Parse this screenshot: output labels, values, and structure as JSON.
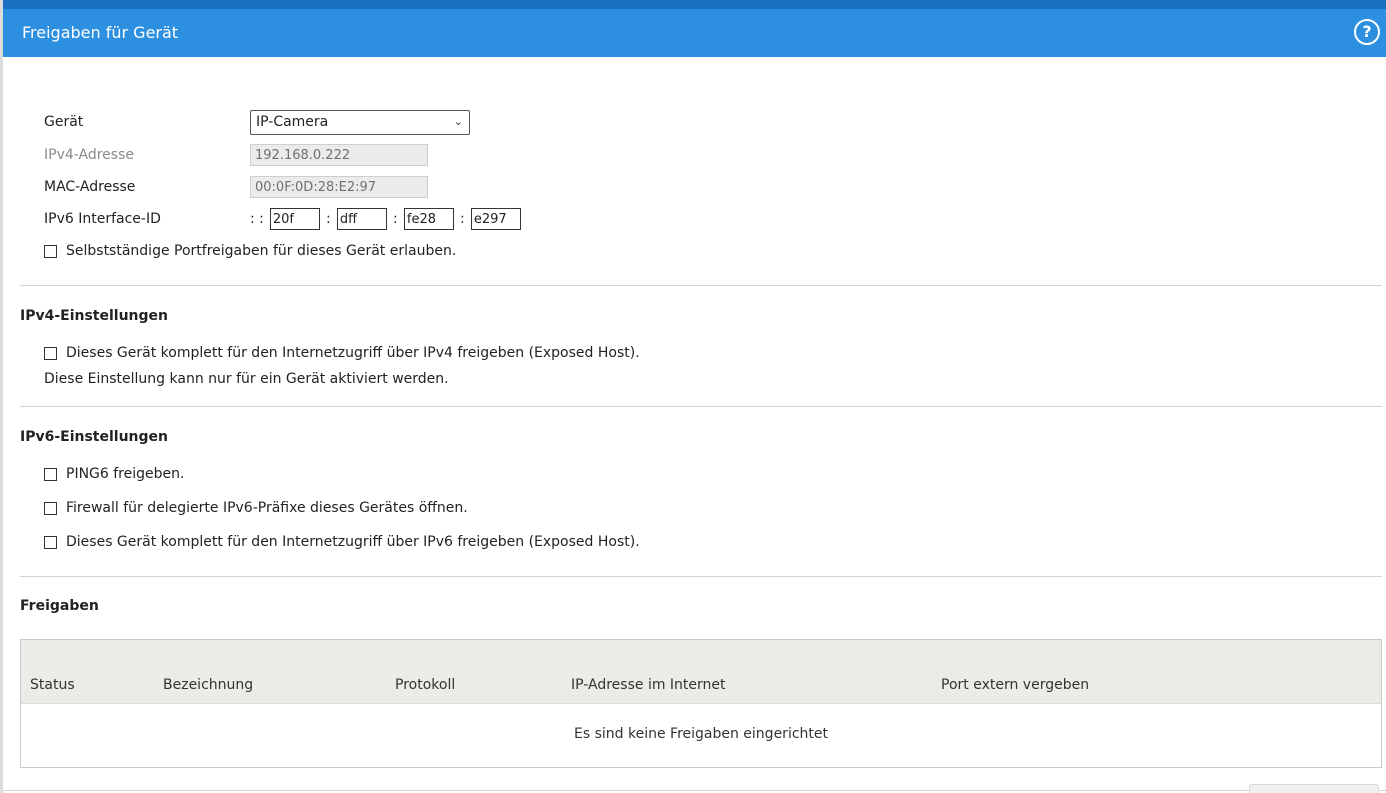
{
  "header": {
    "title": "Freigaben für Gerät",
    "help_icon": "help-icon"
  },
  "device": {
    "label": "Gerät",
    "selected": "IP-Camera",
    "ipv4_label": "IPv4-Adresse",
    "ipv4_value": "192.168.0.222",
    "mac_label": "MAC-Adresse",
    "mac_value": "00:0F:0D:28:E2:97",
    "ipv6_label": "IPv6 Interface-ID",
    "ipv6_prefix": ": :",
    "ipv6_parts": [
      "20f",
      "dff",
      "fe28",
      "e297"
    ],
    "ipv6_sep": ":",
    "auto_port_label": "Selbstständige Portfreigaben für dieses Gerät erlauben."
  },
  "ipv4_settings": {
    "title": "IPv4-Einstellungen",
    "exposed_host_label": "Dieses Gerät komplett für den Internetzugriff über IPv4 freigeben (Exposed Host).",
    "note": "Diese Einstellung kann nur für ein Gerät aktiviert werden."
  },
  "ipv6_settings": {
    "title": "IPv6-Einstellungen",
    "ping6_label": "PING6 freigeben.",
    "firewall_label": "Firewall für delegierte IPv6-Präfixe dieses Gerätes öffnen.",
    "exposed_host_label": "Dieses Gerät komplett für den Internetzugriff über IPv6 freigeben (Exposed Host)."
  },
  "freigaben": {
    "title": "Freigaben",
    "columns": [
      "Status",
      "Bezeichnung",
      "Protokoll",
      "IP-Adresse im Internet",
      "Port extern vergeben"
    ],
    "empty_message": "Es sind keine Freigaben eingerichtet"
  }
}
